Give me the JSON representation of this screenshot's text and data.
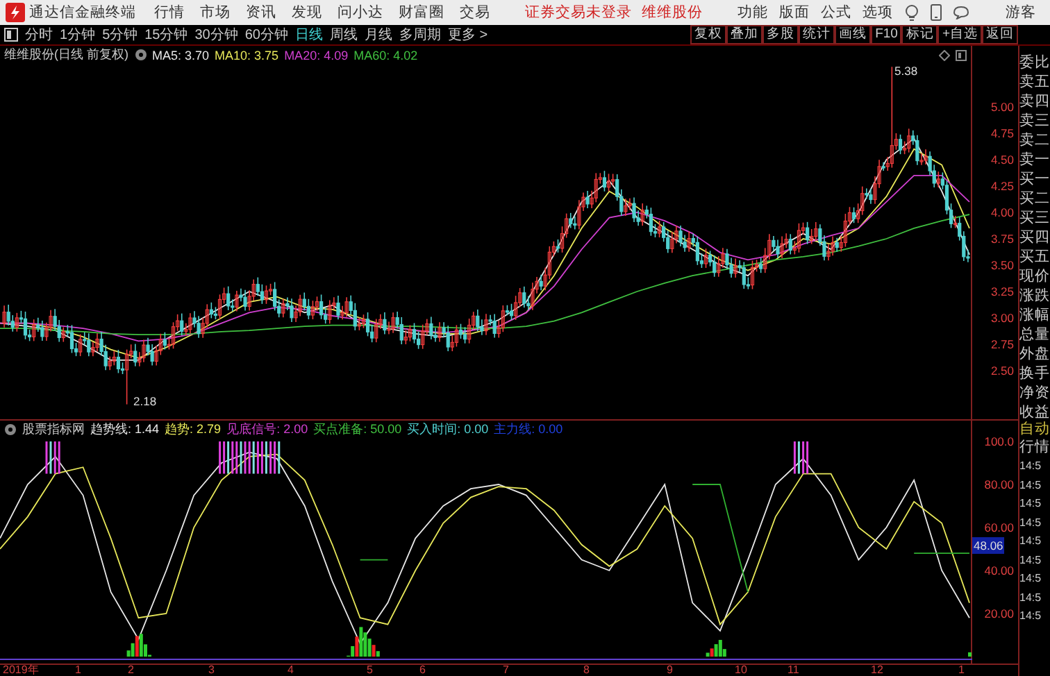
{
  "title_bar": {
    "app_name": "通达信金融终端",
    "menu": [
      "行情",
      "市场",
      "资讯",
      "发现",
      "问小达",
      "财富圈",
      "交易"
    ],
    "notice": "证券交易未登录",
    "stock": "维维股份",
    "tools": [
      "功能",
      "版面",
      "公式",
      "选项"
    ],
    "user": "游客"
  },
  "period_tabs": [
    {
      "label": "分时",
      "selected": false
    },
    {
      "label": "1分钟",
      "selected": false
    },
    {
      "label": "5分钟",
      "selected": false
    },
    {
      "label": "15分钟",
      "selected": false
    },
    {
      "label": "30分钟",
      "selected": false
    },
    {
      "label": "60分钟",
      "selected": false
    },
    {
      "label": "日线",
      "selected": true
    },
    {
      "label": "周线",
      "selected": false
    },
    {
      "label": "月线",
      "selected": false
    },
    {
      "label": "多周期",
      "selected": false
    },
    {
      "label": "更多 >",
      "selected": false
    }
  ],
  "chart_buttons": [
    "复权",
    "叠加",
    "多股",
    "统计",
    "画线",
    "F10",
    "标记",
    "+自选",
    "返回"
  ],
  "price_chart": {
    "title": "维维股份(日线 前复权)",
    "legend": [
      {
        "label": "MA5: 3.70",
        "color": "#e8e8e8"
      },
      {
        "label": "MA10: 3.75",
        "color": "#e8e85a"
      },
      {
        "label": "MA20: 4.09",
        "color": "#d040d0"
      },
      {
        "label": "MA60: 4.02",
        "color": "#40c040"
      }
    ],
    "high_label": "5.38",
    "low_label": "2.18",
    "chart_data": {
      "type": "line",
      "ylim": [
        2.026,
        5.408
      ],
      "yticks": [
        {
          "value": 5,
          "label": "5.00"
        },
        {
          "value": 4.75,
          "label": "4.75"
        },
        {
          "value": 4.5,
          "label": "4.50"
        },
        {
          "value": 4.25,
          "label": "4.25"
        },
        {
          "value": 4,
          "label": "4.00"
        },
        {
          "value": 3.75,
          "label": "3.75"
        },
        {
          "value": 3.5,
          "label": "3.50"
        },
        {
          "value": 3.25,
          "label": "3.25"
        },
        {
          "value": 3,
          "label": "3.00"
        },
        {
          "value": 2.75,
          "label": "2.75"
        },
        {
          "value": 2.5,
          "label": "2.50"
        }
      ],
      "series": [
        {
          "color": "#e8e8e8",
          "values": [
            2.95,
            2.92,
            2.88,
            2.75,
            2.6,
            2.6,
            2.8,
            2.95,
            3.1,
            3.25,
            3.15,
            3.05,
            3.12,
            2.95,
            2.9,
            2.85,
            2.82,
            2.88,
            2.98,
            3.15,
            3.6,
            4.1,
            4.3,
            3.95,
            3.8,
            3.65,
            3.5,
            3.4,
            3.65,
            3.8,
            3.65,
            4.0,
            4.5,
            4.7,
            4.2,
            3.6
          ]
        },
        {
          "color": "#e8e85a",
          "values": [
            2.95,
            2.95,
            2.9,
            2.82,
            2.7,
            2.62,
            2.72,
            2.85,
            3.0,
            3.15,
            3.2,
            3.1,
            3.08,
            3.0,
            2.92,
            2.88,
            2.85,
            2.85,
            2.92,
            3.05,
            3.4,
            3.85,
            4.2,
            4.05,
            3.85,
            3.7,
            3.55,
            3.45,
            3.55,
            3.75,
            3.7,
            3.85,
            4.15,
            4.6,
            4.45,
            3.85
          ]
        },
        {
          "color": "#d040d0",
          "values": [
            2.95,
            2.95,
            2.93,
            2.9,
            2.85,
            2.78,
            2.8,
            2.85,
            2.95,
            3.05,
            3.1,
            3.08,
            3.02,
            2.98,
            2.92,
            2.88,
            2.86,
            2.88,
            2.92,
            3.05,
            3.3,
            3.65,
            3.95,
            4.0,
            3.92,
            3.8,
            3.62,
            3.55,
            3.6,
            3.7,
            3.78,
            3.85,
            4.1,
            4.35,
            4.35,
            4.1
          ]
        },
        {
          "color": "#40c040",
          "values": [
            2.9,
            2.9,
            2.88,
            2.87,
            2.85,
            2.84,
            2.84,
            2.85,
            2.87,
            2.88,
            2.9,
            2.92,
            2.93,
            2.93,
            2.92,
            2.92,
            2.91,
            2.9,
            2.9,
            2.92,
            2.97,
            3.05,
            3.15,
            3.25,
            3.33,
            3.4,
            3.45,
            3.5,
            3.55,
            3.58,
            3.62,
            3.68,
            3.75,
            3.85,
            3.92,
            3.98
          ]
        }
      ]
    }
  },
  "indicator_chart": {
    "title": "股票指标网",
    "legend": [
      {
        "label": "趋势线: 1.44",
        "color": "#e8e8e8"
      },
      {
        "label": "趋势: 2.79",
        "color": "#e8e85a"
      },
      {
        "label": "见底信号: 2.00",
        "color": "#d040d0"
      },
      {
        "label": "买点准备: 50.00",
        "color": "#40c040"
      },
      {
        "label": "买入时间: 0.00",
        "color": "#50d0d0"
      },
      {
        "label": "主力线: 0.00",
        "color": "#2040e0"
      }
    ],
    "chart_data": {
      "type": "line",
      "ylim": [
        -3.2,
        101.3
      ],
      "yticks": [
        {
          "value": 100,
          "label": "100.0"
        },
        {
          "value": 80,
          "label": "80.00"
        },
        {
          "value": 60,
          "label": "60.00"
        },
        {
          "value": 40,
          "label": "40.00"
        },
        {
          "value": 20,
          "label": "20.00"
        }
      ],
      "series": [
        {
          "color": "#e8e8e8",
          "values": [
            55,
            80,
            93,
            75,
            30,
            8,
            40,
            75,
            90,
            95,
            92,
            70,
            35,
            6,
            25,
            55,
            70,
            78,
            80,
            75,
            60,
            45,
            40,
            60,
            80,
            25,
            12,
            45,
            80,
            92,
            75,
            45,
            60,
            82,
            40,
            18
          ]
        },
        {
          "color": "#e8e85a",
          "values": [
            50,
            65,
            85,
            88,
            55,
            18,
            20,
            60,
            82,
            93,
            94,
            82,
            52,
            18,
            15,
            40,
            62,
            74,
            79,
            78,
            68,
            52,
            42,
            50,
            70,
            55,
            15,
            30,
            65,
            85,
            85,
            60,
            50,
            72,
            62,
            25
          ]
        },
        {
          "color": "#30b030",
          "values": [
            null,
            null,
            null,
            null,
            null,
            null,
            null,
            null,
            null,
            null,
            null,
            null,
            null,
            45,
            45,
            null,
            null,
            null,
            null,
            null,
            null,
            null,
            null,
            null,
            null,
            80,
            80,
            30,
            null,
            null,
            null,
            null,
            null,
            48,
            48,
            48
          ]
        }
      ]
    },
    "cursor_value": "48.06"
  },
  "time_axis": [
    "2019年",
    "1",
    "2",
    "3",
    "4",
    "5",
    "6",
    "7",
    "8",
    "9",
    "10",
    "11",
    "12",
    "1"
  ],
  "quote_panel": {
    "fields": [
      "委比",
      "卖五",
      "卖四",
      "卖三",
      "卖二",
      "卖一",
      "买一",
      "买二",
      "买三",
      "买四",
      "买五",
      "现价",
      "涨跌",
      "涨幅",
      "总量",
      "外盘",
      "换手",
      "净资",
      "收益"
    ],
    "ticks_header": [
      "自动",
      "行情"
    ],
    "ticks": [
      "14:5",
      "14:5",
      "14:5",
      "14:5",
      "14:5",
      "14:5",
      "14:5",
      "14:5",
      "14:5"
    ]
  }
}
